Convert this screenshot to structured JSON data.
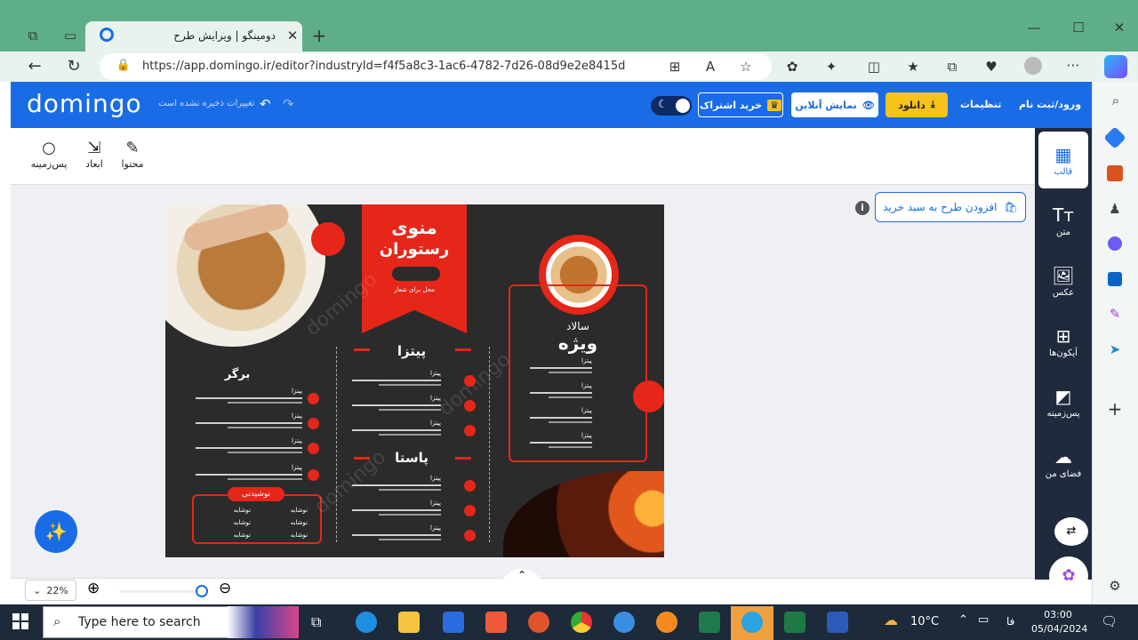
{
  "browser": {
    "tab_title": "دومینگو | ویرایش طرح",
    "url": "https://app.domingo.ir/editor?industryId=f4f5a8c3-1ac6-4782-7d26-08d9e2e8415d"
  },
  "header": {
    "logo": "domingo",
    "save_status": "تغییرات ذخیره نشده است",
    "subscribe": "خرید اشتراک",
    "online_preview": "نمایش آنلاین",
    "download": "دانلود",
    "settings": "تنظیمات",
    "login": "ورود/ثبت نام"
  },
  "toolbar": {
    "content": "محتوا",
    "dimensions": "ابعاد",
    "background": "پس‌زمینه"
  },
  "canvas": {
    "add_to_cart": "افزودن طرح به سبد خرید"
  },
  "design": {
    "title_line1": "منوی",
    "title_line2": "رستوران",
    "banner_sub": "محل برای شعار",
    "watermark": "domingo",
    "pizza_header": "پیتزا",
    "pasta_header": "پاستا",
    "burger_header": "برگر",
    "salad_header_small": "سالاد",
    "salad_header_big": "ویژه",
    "drinks_header": "نوشیدنی",
    "item_name": "پیتزا",
    "drink_name": "نوشابه"
  },
  "zoom": {
    "label": "22%",
    "level": 0.22
  },
  "sidebar": {
    "items": [
      {
        "label": "قالب",
        "icon": "template-icon"
      },
      {
        "label": "متن",
        "icon": "text-icon"
      },
      {
        "label": "عکس",
        "icon": "image-icon"
      },
      {
        "label": "آیکون‌ها",
        "icon": "icons-grid-icon"
      },
      {
        "label": "پس‌زمینه",
        "icon": "background-icon"
      },
      {
        "label": "فضای من",
        "icon": "cloud-upload-icon"
      }
    ]
  },
  "taskbar": {
    "search_placeholder": "Type here to search",
    "temperature": "10°C",
    "language": "فا",
    "time": "03:00",
    "date": "05/04/2024"
  },
  "colors": {
    "brand_blue": "#1a6ce6",
    "menu_red": "#e52619",
    "menu_bg": "#2b2b2b",
    "download_yellow": "#f7c21a"
  }
}
